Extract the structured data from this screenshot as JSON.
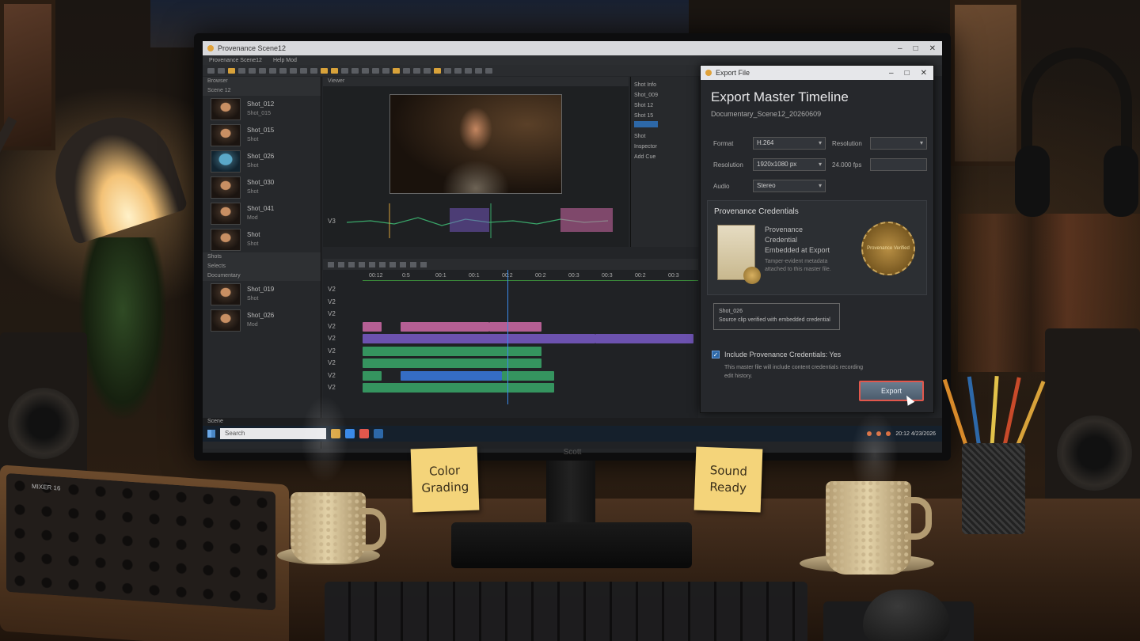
{
  "app": {
    "title": "Provenance Scene12",
    "menu": [
      "Provenance Scene12",
      "Help Mod"
    ],
    "status": "Scene"
  },
  "bins": {
    "panel_label": "Browser",
    "top_group": "Scene 12",
    "clips_top": [
      {
        "name": "Shot_012",
        "sub": "Shot_015"
      },
      {
        "name": "Shot_015",
        "sub": "Shot"
      },
      {
        "name": "Shot_026",
        "sub": "Shot"
      },
      {
        "name": "Shot_030",
        "sub": "Shot"
      },
      {
        "name": "Shot_041",
        "sub": "Mod"
      },
      {
        "name": "Shot",
        "sub": "Shot"
      }
    ],
    "section_label": "Shots",
    "bottom_group": "Selects",
    "bottom_sub": "Documentary",
    "clips_bottom": [
      {
        "name": "Shot_019",
        "sub": "Shot"
      },
      {
        "name": "Shot_026",
        "sub": "Mod"
      }
    ]
  },
  "viewer": {
    "title": "Viewer",
    "track_label": "V3"
  },
  "inspector": {
    "title": "Shot Info",
    "rows": [
      "Shot_009",
      "Shot 12",
      "Shot 15",
      "Shot",
      "Inspector"
    ],
    "action": "Add Cue"
  },
  "timeline": {
    "ruler_ticks": [
      "00:12",
      "0:5",
      "00:1",
      "00:1",
      "00:2",
      "00:2",
      "00:3",
      "00:3",
      "00:2",
      "00:3"
    ],
    "tracks": [
      "V2",
      "V2",
      "V2",
      "V2",
      "V2",
      "V2",
      "V2",
      "V2",
      "V2"
    ]
  },
  "export_dialog": {
    "window_title": "Export File",
    "title": "Export Master Timeline",
    "subtitle": "Documentary_Scene12_20260609",
    "format_label": "Format",
    "format_value": "H.264",
    "resolution_label": "Resolution",
    "resolution_value": "1920x1080 px",
    "framerate_value": "24.000 fps",
    "audio_label": "Audio",
    "audio_value": "Stereo",
    "right_label": "Resolution",
    "provenance": {
      "title": "Provenance Credentials",
      "cred_line1": "Provenance",
      "cred_line2": "Credential",
      "cred_line3": "Embedded at Export",
      "note": "Tamper-evident metadata attached to this master file.",
      "seal": "Provenance Verified"
    },
    "shot_box_title": "Shot_026",
    "shot_box_text": "Source clip verified with embedded credential",
    "checkbox_label": "Include Provenance Credentials: Yes",
    "checkbox_note": "This master file will include content credentials recording edit history.",
    "export_button": "Export"
  },
  "taskbar": {
    "search_placeholder": "Search",
    "clock": "20:12 4/23/2026"
  },
  "monitor_brand": "Scott",
  "sticky_notes": {
    "left_line1": "Color",
    "left_line2": "Grading",
    "right_line1": "Sound",
    "right_line2": "Ready"
  },
  "mixer_label": "MIXER 16",
  "colors": {
    "accent": "#d8a23a",
    "export_border": "#e2574c",
    "playhead": "#3a8ae8",
    "clip_pink": "#d06aa8",
    "clip_purple": "#7a5ac8",
    "clip_green": "#3aa86a",
    "clip_blue": "#3a7ae0"
  }
}
